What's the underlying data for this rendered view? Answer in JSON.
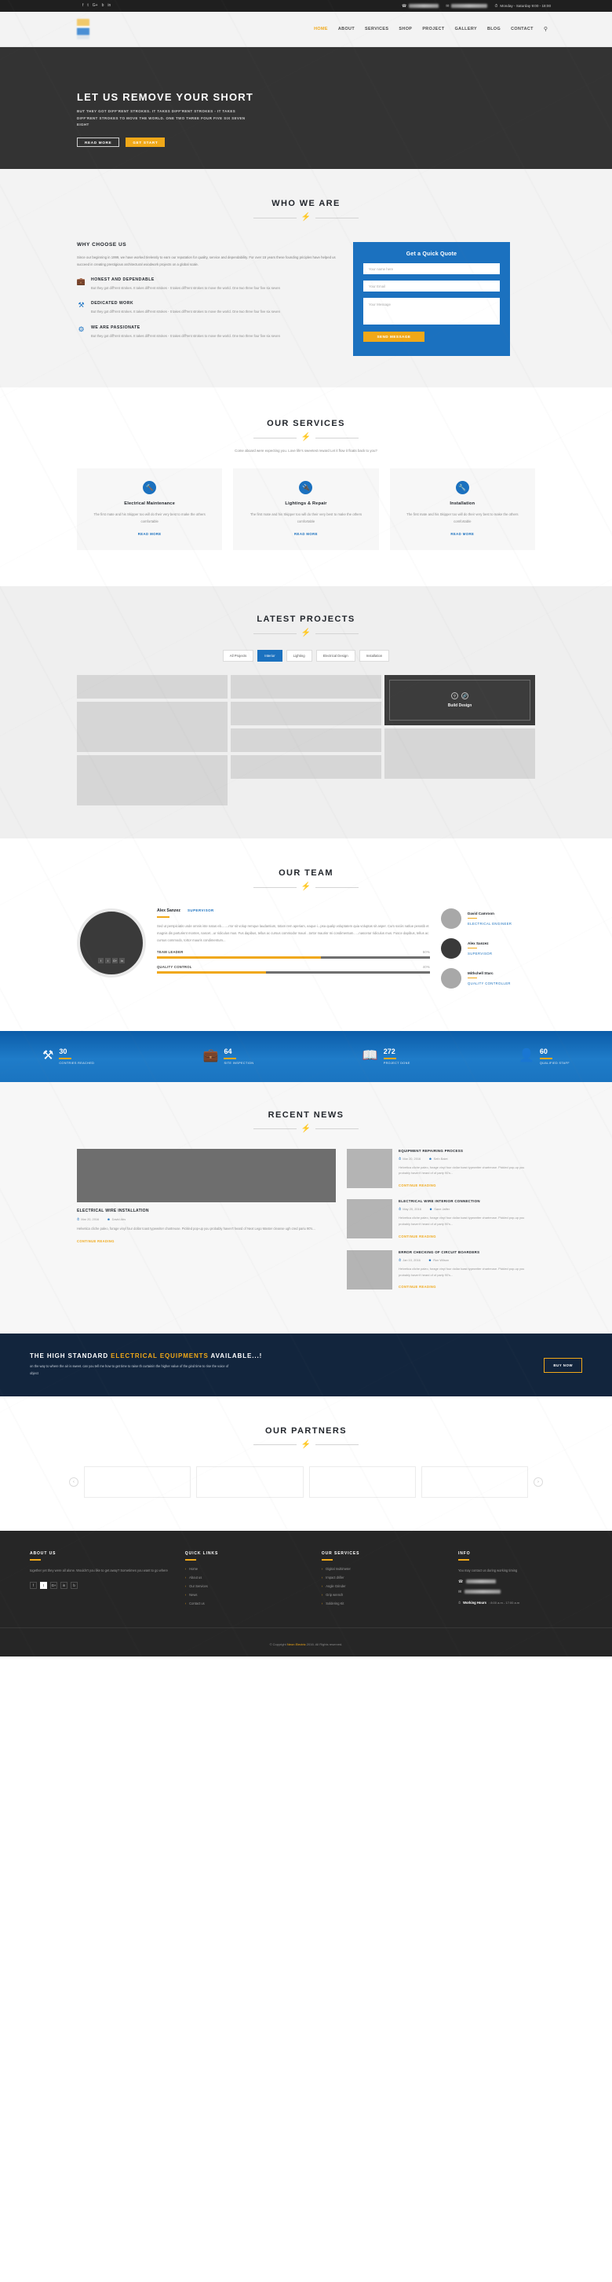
{
  "topbar": {
    "social": [
      "f",
      "t",
      "G+",
      "b",
      "in"
    ],
    "phone_masked": true,
    "email_masked": true,
    "hours": "Monday - Saturday 9:00 - 18:00",
    "phone_icon": "phone-icon",
    "mail_icon": "mail-icon",
    "clock_icon": "clock-icon"
  },
  "nav": {
    "items": [
      "HOME",
      "ABOUT",
      "SERVICES",
      "SHOP",
      "PROJECT",
      "GALLERY",
      "BLOG",
      "CONTACT"
    ],
    "active": "HOME",
    "search_icon": "search-icon"
  },
  "hero": {
    "title": "LET US REMOVE YOUR SHORT",
    "text": "BUT THEY GOT DIFF'RENT STROKES. IT TAKES DIFF'RENT STROKES - IT TAKES DIFF'RENT STROKES TO MOVE THE WORLD. ONE TWO THREE FOUR FIVE SIX SEVEN EIGHT",
    "btn_primary": "READ MORE",
    "btn_secondary": "GET START"
  },
  "who": {
    "title": "WHO WE ARE",
    "heading": "WHY CHOOSE US",
    "lead": "Since our beginning in 1999, we have worked tirelessly to earn our reputation for quality, service and dependability. For over 15 years these founding priciples have helped us succeed in creating prestigious architectural woodwork projects on a global scale.",
    "features": [
      {
        "icon": "toolbox-icon",
        "title": "HONEST AND DEPENDABLE",
        "text": "But they got diff'rent strokes. It takes diff'rent strokes - It takes diff'rent strokes to move the world. One two three four five six seven"
      },
      {
        "icon": "tools-icon",
        "title": "DEDICATED WORK",
        "text": "But they got diff'rent strokes. It takes diff'rent strokes - It takes diff'rent strokes to move the world. One two three four five six seven"
      },
      {
        "icon": "passion-icon",
        "title": "WE ARE PASSIONATE",
        "text": "But they got diff'rent strokes. It takes diff'rent strokes - It takes diff'rent strokes to move the world. One two three four five six seven"
      }
    ],
    "form": {
      "title": "Get a Quick Quote",
      "name_placeholder": "Your name here",
      "email_placeholder": "Your Email",
      "message_placeholder": "Your Message",
      "submit": "SEND MESSAGE"
    }
  },
  "services": {
    "title": "OUR SERVICES",
    "subtitle": "Come aboard were expecting you. Love life's sweetest reward Let it flow it floats back to you?",
    "items": [
      {
        "icon": "screwdriver-icon",
        "title": "Electrical Maintenance",
        "text": "The first mate and his Skipper too will do their very best to make the others comfortable",
        "link": "READ MORE"
      },
      {
        "icon": "plug-icon",
        "title": "Lightings & Repair",
        "text": "The first mate and his Skipper too will do their very best to make the others comfortable",
        "link": "READ MORE"
      },
      {
        "icon": "wrench-icon",
        "title": "Installation",
        "text": "The first mate and his Skipper too will do their very best to make the others comfortable",
        "link": "READ MORE"
      }
    ]
  },
  "projects": {
    "title": "LATEST PROJECTS",
    "filters": [
      "All Projects",
      "Interior",
      "Lighting",
      "Electrical Design",
      "Installation"
    ],
    "active_filter": "Interior",
    "featured": {
      "title": "Build Design",
      "zoom_icon": "search-icon",
      "link_icon": "link-icon"
    }
  },
  "team": {
    "title": "OUR TEAM",
    "featured": {
      "name": "Alex Sanzez",
      "role": "SUPERVISOR",
      "bio": "Sed ut perspiciatis unde omnis iste natus eb........rror sit volup remque laudantium, totam rem aperiam, eaque i...psa qualip voluptatem quia voluptas sit asper. Cum sociis natlue penatib et magnis dis parturient montes, nascet...ur ridiculus mus. Fus dapibus, tellus ac cursus commodor mauri ..tortor maurisr mi condimentum.. ...nascetur ridiculus mus. Fusce dapibus, tellus ac cursus commodo, tortor mauris condimentum...",
      "socials": [
        "f",
        "t",
        "G+",
        "in"
      ],
      "skills": [
        {
          "label": "TEAM LEADER",
          "value": 60
        },
        {
          "label": "QUALITY CONTROL",
          "value": 40
        }
      ]
    },
    "members": [
      {
        "name": "David Camroon",
        "role": "ELECTRICAL ENGINEER",
        "dark": false
      },
      {
        "name": "Alex Sanzez",
        "role": "SUPERVISOR",
        "dark": true
      },
      {
        "name": "Mithchell Starc",
        "role": "QUALITY CONTROLLER",
        "dark": false
      }
    ]
  },
  "stats": [
    {
      "icon": "tools-icon",
      "number": "30",
      "label": "CONTRIES REACHED"
    },
    {
      "icon": "toolbox-icon",
      "number": "64",
      "label": "SITE INSPECTION"
    },
    {
      "icon": "book-icon",
      "number": "272",
      "label": "PROJECT DONE"
    },
    {
      "icon": "user-icon",
      "number": "60",
      "label": "QUALIFIED STAFF"
    }
  ],
  "news": {
    "title": "RECENT NEWS",
    "main": {
      "title": "ELECTRICAL WIRE INSTALLATION",
      "date": "Mar 20, 2016",
      "author": "David Abs",
      "text": "Helvetica cliche paleo, forage vinyl four dollar toast typewriter chartreuse. Pickled pop-up you probably haven't heard of Next Lego Master cleanse ugh cred pariu 90's...",
      "link": "CONTINUE READING"
    },
    "side": [
      {
        "title": "EQUIPMENT REPAIRING PROCESS",
        "date": "Mar 20, 2016",
        "author": "Seth Balet",
        "text": "Helvetica cliche paleo, forage vinyl four dollar toast typewriter chartreuse. Pickled pop-up you probably haven't heard of of party 90's...",
        "link": "CONTINUE READING"
      },
      {
        "title": "ELECTRICAL WIRE INTERIOR CONNECTION",
        "date": "May 20, 2016",
        "author": "Sane Jaffer",
        "text": "Helvetica cliche paleo, forage vinyl four dollar toast typewriter chartreuse. Pickled pop-up you probably haven't heard of of party 90's...",
        "link": "CONTINUE READING"
      },
      {
        "title": "ERROR CHECKING OF CIRCUIT BOARDERS",
        "date": "Jan 10, 2016",
        "author": "Ron Wilson",
        "text": "Helvetica cliche paleo, forage vinyl four dollar toast typewriter chartreuse. Pickled pop-up you probably haven't heard of of party 90's...",
        "link": "CONTINUE READING"
      }
    ]
  },
  "cta": {
    "title_a": "THE HIGH STANDARD ",
    "title_em": "ELECTRICAL EQUIPMENTS",
    "title_b": " AVAILABLE...!",
    "text": "on the way to where the air is sweet. can you tell me how to get time to raise th curtainin the higher value of the gind time to rise the voice of object",
    "button": "BUY NOW"
  },
  "partners": {
    "title": "OUR PARTNERS",
    "prev_icon": "chevron-left-icon",
    "next_icon": "chevron-right-icon",
    "count": 4
  },
  "footer": {
    "about": {
      "heading": "ABOUT US",
      "text": "together yet they were all alone. Wouldn't you like to get away? Sometimes you want to go where",
      "socials": [
        "f",
        "t",
        "G+",
        "in",
        "b"
      ]
    },
    "quick": {
      "heading": "QUICK LINKS",
      "items": [
        "Home",
        "About us",
        "Our Services",
        "News",
        "Contact us"
      ]
    },
    "services": {
      "heading": "OUR SERVICES",
      "items": [
        "Digital multimeter",
        "Impact driller",
        "Angle Grinder",
        "Grip wrench",
        "Soldering Kit"
      ]
    },
    "info": {
      "heading": "INFO",
      "text": "You may contact us during working timing",
      "phone_masked": true,
      "email_masked": true,
      "hours_label": "Working Hours",
      "hours_value": ": 8:00 a.m - 17:00 a.m"
    },
    "copyright_a": "© Copyright ",
    "copyright_em": "Neon Electric",
    "copyright_b": " 2016. All Rights reserved."
  },
  "colors": {
    "accent_blue": "#1b71bf",
    "accent_orange": "#f0a818",
    "dark": "#262626"
  }
}
